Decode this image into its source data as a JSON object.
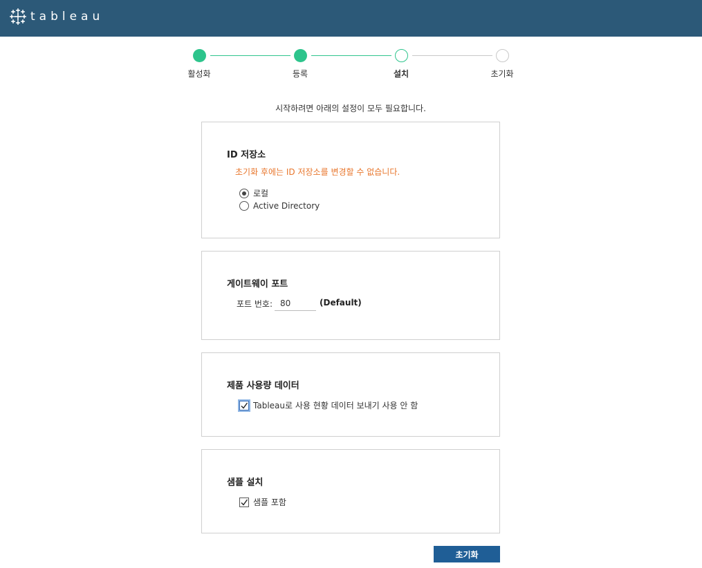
{
  "brand": {
    "name": "tableau",
    "color": "#2c5978"
  },
  "stepper": {
    "steps": [
      {
        "label": "활성화",
        "state": "done"
      },
      {
        "label": "등록",
        "state": "done"
      },
      {
        "label": "설치",
        "state": "current"
      },
      {
        "label": "초기화",
        "state": "future"
      }
    ],
    "accent": "#2dc48c"
  },
  "intro": "시작하려면 아래의 설정이 모두 필요합니다.",
  "identity_store": {
    "title": "ID 저장소",
    "warning": "초기화 후에는 ID 저장소를 변경할 수 없습니다.",
    "options": [
      {
        "label": "로컬",
        "selected": true
      },
      {
        "label": "Active Directory",
        "selected": false
      }
    ]
  },
  "gateway": {
    "title": "게이트웨이 포트",
    "port_label": "포트 번호:",
    "port_value": "80",
    "default_label": "(Default)"
  },
  "usage": {
    "title": "제품 사용량 데이터",
    "checkbox_label": "Tableau로 사용 현황 데이터 보내기 사용 안 함",
    "checked": true
  },
  "samples": {
    "title": "샘플 설치",
    "checkbox_label": "샘플 포함",
    "checked": true
  },
  "actions": {
    "initialize_label": "초기화"
  }
}
